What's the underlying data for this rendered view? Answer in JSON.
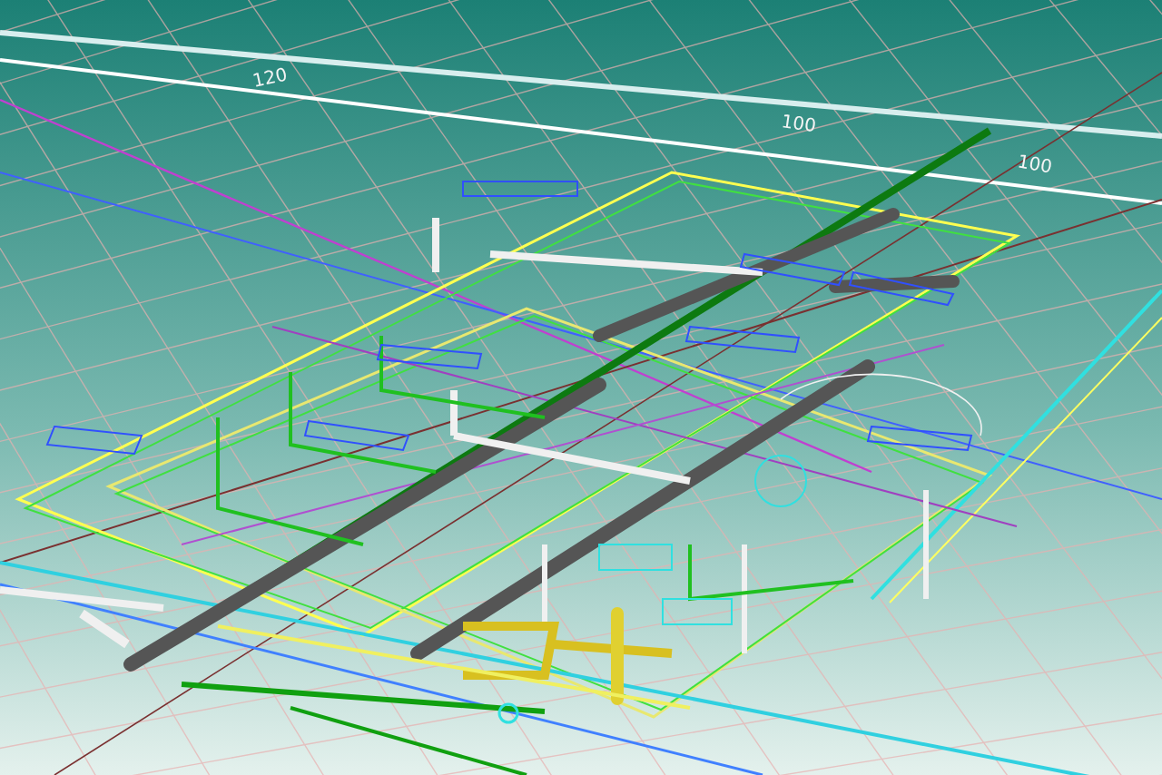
{
  "view": {
    "dimension_labels": [
      {
        "text": "120"
      },
      {
        "text": "100"
      },
      {
        "text": "100"
      }
    ]
  }
}
